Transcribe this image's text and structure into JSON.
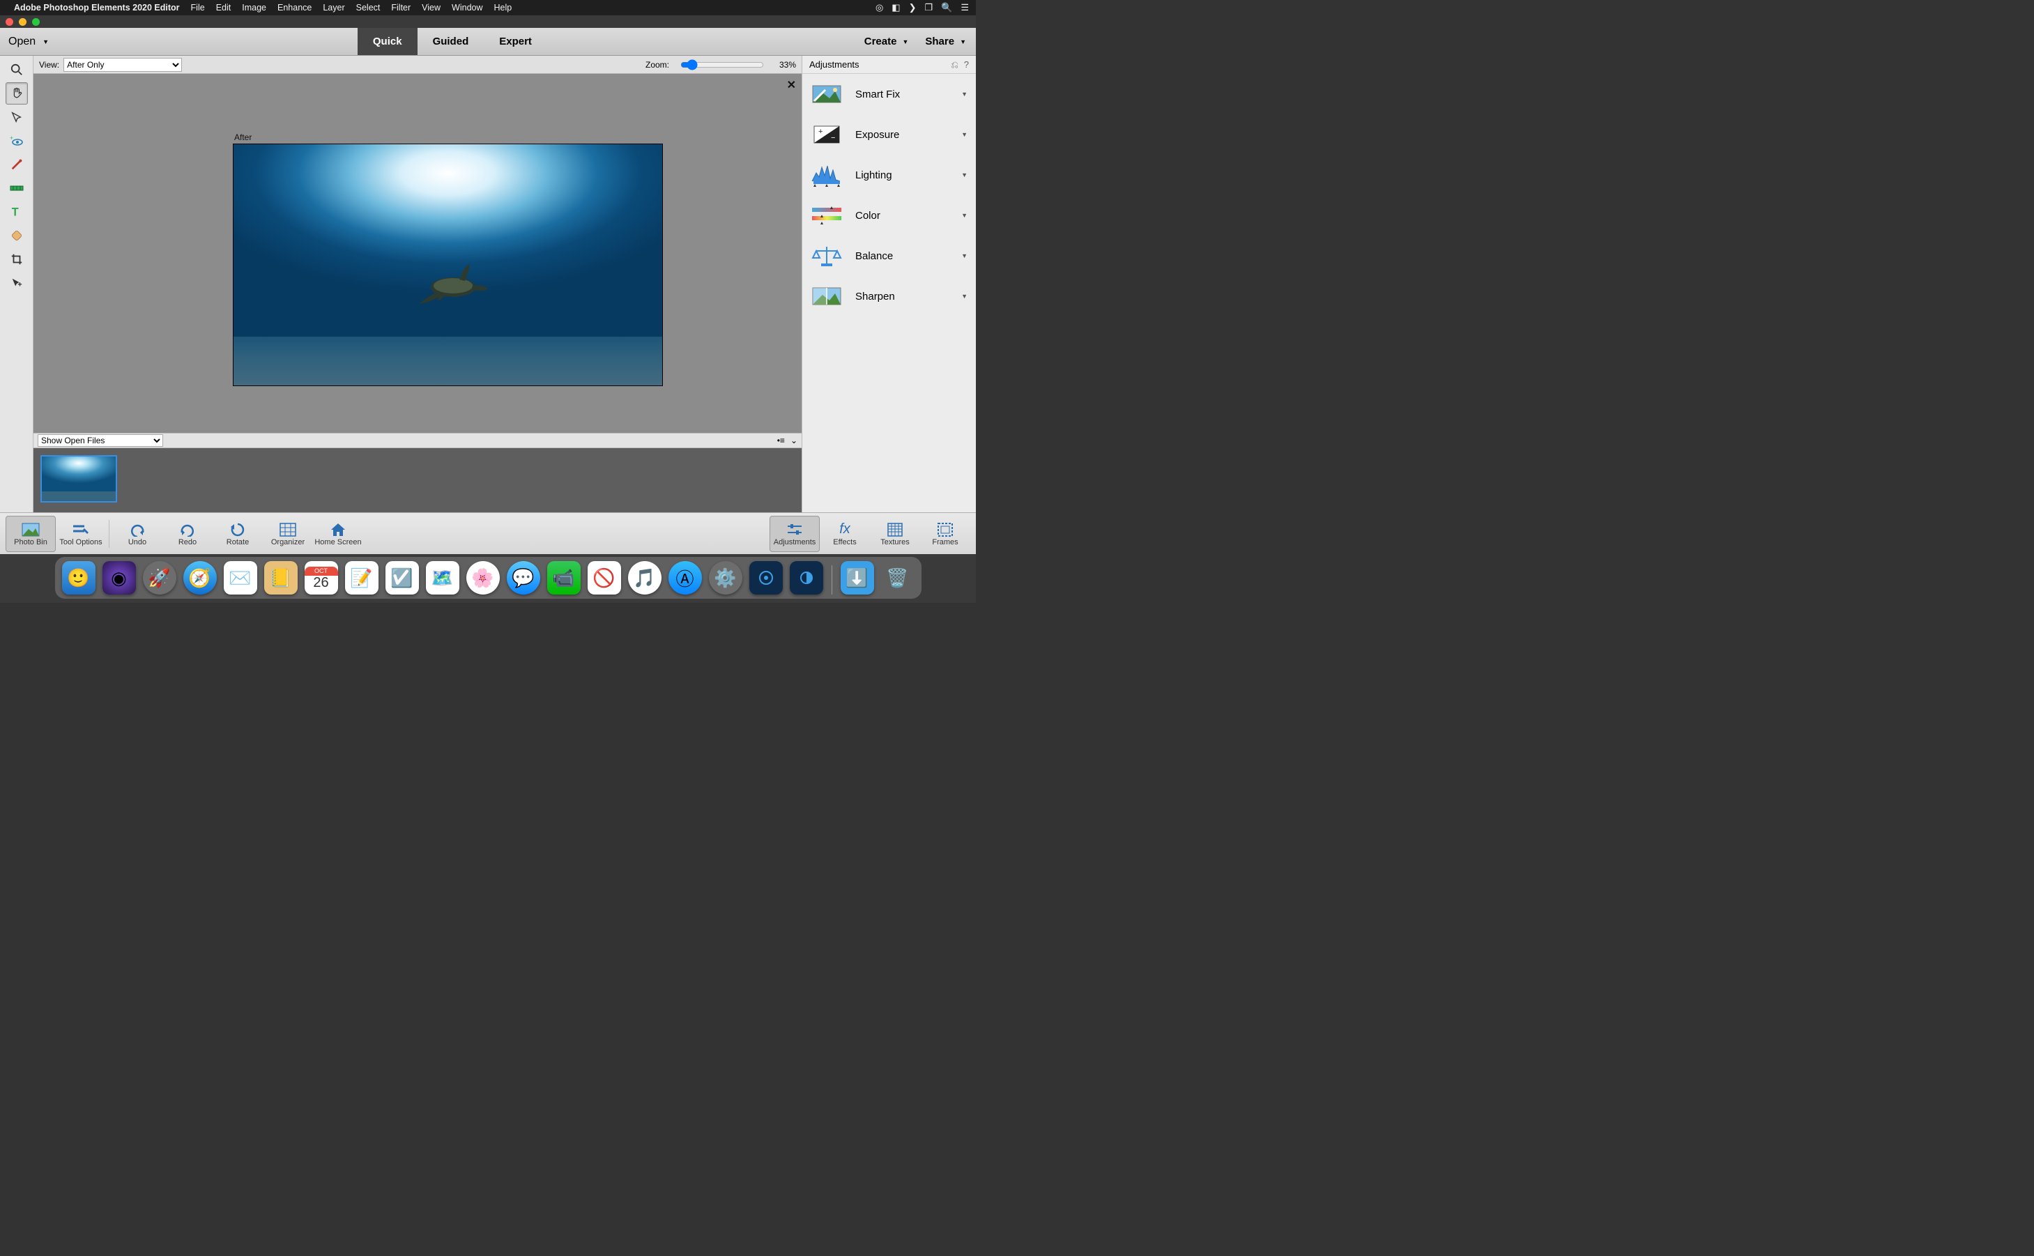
{
  "menubar": {
    "app_name": "Adobe Photoshop Elements 2020 Editor",
    "items": [
      "File",
      "Edit",
      "Image",
      "Enhance",
      "Layer",
      "Select",
      "Filter",
      "View",
      "Window",
      "Help"
    ]
  },
  "toolbar": {
    "open_label": "Open",
    "modes": {
      "quick": "Quick",
      "guided": "Guided",
      "expert": "Expert"
    },
    "create_label": "Create",
    "share_label": "Share"
  },
  "viewbar": {
    "view_label": "View:",
    "view_value": "After Only",
    "zoom_label": "Zoom:",
    "zoom_value": "33%"
  },
  "canvas": {
    "after_label": "After"
  },
  "binbar": {
    "select_value": "Show Open Files"
  },
  "adjustments": {
    "title": "Adjustments",
    "items": [
      "Smart Fix",
      "Exposure",
      "Lighting",
      "Color",
      "Balance",
      "Sharpen"
    ]
  },
  "bottombar": {
    "photo_bin": "Photo Bin",
    "tool_options": "Tool Options",
    "undo": "Undo",
    "redo": "Redo",
    "rotate": "Rotate",
    "organizer": "Organizer",
    "home_screen": "Home Screen",
    "adjustments": "Adjustments",
    "effects": "Effects",
    "textures": "Textures",
    "frames": "Frames"
  },
  "dock": {
    "calendar_month": "OCT",
    "calendar_day": "26"
  }
}
